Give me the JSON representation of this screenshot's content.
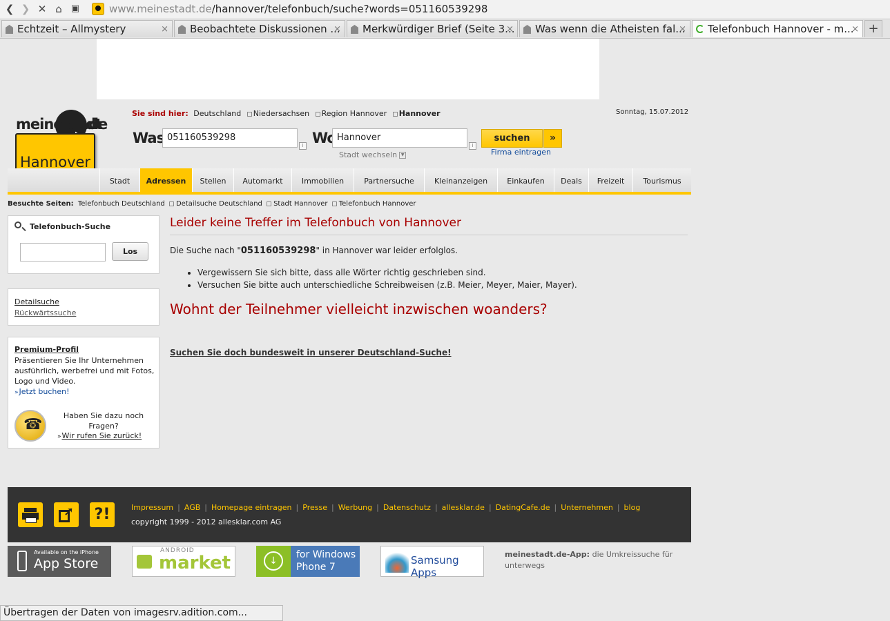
{
  "browser": {
    "url_domain": "www.meinestadt.de",
    "url_path": "/hannover/telefonbuch/suche?words=051160539298",
    "tabs": [
      {
        "label": "Echtzeit – Allmystery"
      },
      {
        "label": "Beobachtete Diskussionen ..."
      },
      {
        "label": "Merkwürdiger Brief (Seite 3..."
      },
      {
        "label": "Was wenn die Atheisten fal..."
      },
      {
        "label": "Telefonbuch Hannover - m..."
      }
    ],
    "new_tab": "+",
    "close_glyph": "×",
    "status_text": "Übertragen der Daten von imagesrv.adition.com..."
  },
  "logo": {
    "brand": "meinestadt",
    "tld": ".de",
    "city": "Hannover"
  },
  "breadcrumb": {
    "label": "Sie sind hier:",
    "items": [
      "Deutschland",
      "Niedersachsen",
      "Region Hannover",
      "Hannover"
    ]
  },
  "date": "Sonntag, 15.07.2012",
  "search": {
    "was_label": "Was",
    "was_value": "051160539298",
    "wo_label": "Wo",
    "wo_value": "Hannover",
    "info": "i",
    "stadt_wechseln": "Stadt wechseln",
    "submit": "suchen",
    "arrow": "»",
    "firma_eintragen": "Firma eintragen"
  },
  "nav": [
    "Stadt",
    "Adressen",
    "Stellen",
    "Automarkt",
    "Immobilien",
    "Partnersuche",
    "Kleinanzeigen",
    "Einkaufen",
    "Deals",
    "Freizeit",
    "Tourismus"
  ],
  "visited": {
    "label": "Besuchte Seiten:",
    "items": [
      "Telefonbuch Deutschland",
      "Detailsuche Deutschland",
      "Stadt Hannover",
      "Telefonbuch Hannover"
    ]
  },
  "sidebar": {
    "tb_title": "Telefonbuch-Suche",
    "tb_button": "Los",
    "links": [
      "Detailsuche",
      "Rückwärtssuche"
    ],
    "premium_title": "Premium-Profil",
    "premium_text": "Präsentieren Sie Ihr Unternehmen ausführlich, werbefrei und mit Fotos, Logo und Video.",
    "premium_link": "Jetzt buchen!",
    "question": "Haben Sie dazu noch Fragen?",
    "callback": "Wir rufen Sie zurück!"
  },
  "main": {
    "heading": "Leider keine Treffer im Telefonbuch von Hannover",
    "msg_pre": "Die Suche nach \"",
    "msg_term": "051160539298",
    "msg_post": "\" in Hannover war leider erfolglos.",
    "tips": [
      "Vergewissern Sie sich bitte, dass alle Wörter richtig geschrieben sind.",
      "Versuchen Sie bitte auch unterschiedliche Schreibweisen (z.B. Meier, Meyer, Maier, Mayer)."
    ],
    "heading2": "Wohnt der Teilnehmer vielleicht inzwischen woanders?",
    "bund_link": "Suchen Sie doch bundesweit in unserer Deutschland-Suche!"
  },
  "footer": {
    "links": [
      "Impressum",
      "AGB",
      "Homepage eintragen",
      "Presse",
      "Werbung",
      "Datenschutz",
      "allesklar.de",
      "DatingCafe.de",
      "Unternehmen",
      "blog"
    ],
    "copyright": "copyright 1999 - 2012 allesklar.com AG",
    "icon_help": "?!"
  },
  "apps": {
    "appstore_small": "Available on the iPhone",
    "appstore_big": "App Store",
    "android_small": "ANDROID",
    "android_big": "market",
    "windows_1": "for Windows",
    "windows_2": "Phone 7",
    "samsung": "Samsung Apps",
    "desc_bold": "meinestadt.de-App:",
    "desc_text": " die Umkreissuche für unterwegs"
  }
}
